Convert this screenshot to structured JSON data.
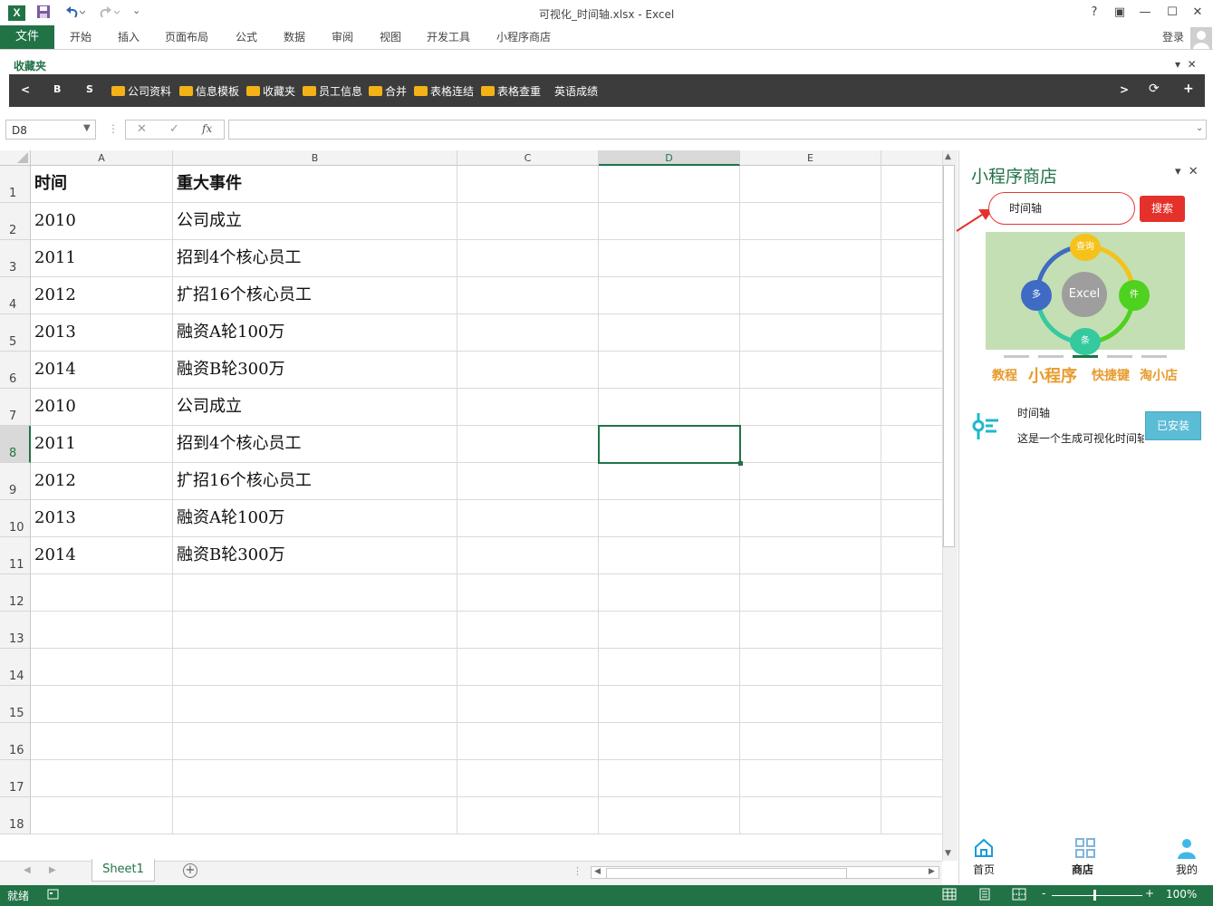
{
  "window": {
    "title": "可视化_时间轴.xlsx - Excel",
    "logo_text": "X",
    "controls": [
      "?",
      "▣",
      "—",
      "☐",
      "✕"
    ]
  },
  "ribbon": {
    "file_tab": "文件",
    "tabs": [
      "开始",
      "插入",
      "页面布局",
      "公式",
      "数据",
      "审阅",
      "视图",
      "开发工具",
      "小程序商店"
    ],
    "login": "登录"
  },
  "favorites": {
    "title": "收藏夹",
    "nav_left": "<",
    "nav_b": "B",
    "nav_s": "S",
    "items": [
      "公司资料",
      "信息模板",
      "收藏夹",
      "员工信息",
      "合并",
      "表格连结",
      "表格查重"
    ],
    "extra_item": "英语成绩",
    "nav_right": ">",
    "refresh": "⟳",
    "add": "+"
  },
  "formula_bar": {
    "name_box": "D8",
    "cancel": "✕",
    "confirm": "✓",
    "fx": "fx",
    "value": ""
  },
  "sheet": {
    "columns": [
      "A",
      "B",
      "C",
      "D",
      "E"
    ],
    "rows": [
      "1",
      "2",
      "3",
      "4",
      "5",
      "6",
      "7",
      "8",
      "9",
      "10",
      "11",
      "12",
      "13",
      "14",
      "15",
      "16",
      "17",
      "18"
    ],
    "selected_cell": "D8",
    "data": [
      [
        "时间",
        "重大事件"
      ],
      [
        "2010",
        "公司成立"
      ],
      [
        "2011",
        "招到4个核心员工"
      ],
      [
        "2012",
        "扩招16个核心员工"
      ],
      [
        "2013",
        "融资A轮100万"
      ],
      [
        "2014",
        "融资B轮300万"
      ],
      [
        "2010",
        "公司成立"
      ],
      [
        "2011",
        "招到4个核心员工"
      ],
      [
        "2012",
        "扩招16个核心员工"
      ],
      [
        "2013",
        "融资A轮100万"
      ],
      [
        "2014",
        "融资B轮300万"
      ]
    ],
    "tab_name": "Sheet1"
  },
  "status": {
    "ready": "就绪",
    "zoom": "100%",
    "zoom_minus": "-",
    "zoom_plus": "+"
  },
  "pane": {
    "title": "小程序商店",
    "search_value": "时间轴",
    "search_button": "搜索",
    "banner": {
      "center": "Excel",
      "nodes": [
        "查询",
        "件",
        "条",
        "多"
      ]
    },
    "quick_links": [
      "教程",
      "小程序",
      "快捷键",
      "淘小店"
    ],
    "app": {
      "title": "时间轴",
      "description": "这是一个生成可视化时间轴",
      "button": "已安装"
    },
    "bottom_nav": [
      "首页",
      "商店",
      "我的"
    ]
  },
  "colors": {
    "excel_green": "#217346",
    "accent_red": "#e5312b",
    "link_orange": "#e89b2e",
    "installed_blue": "#5bbcd6"
  }
}
